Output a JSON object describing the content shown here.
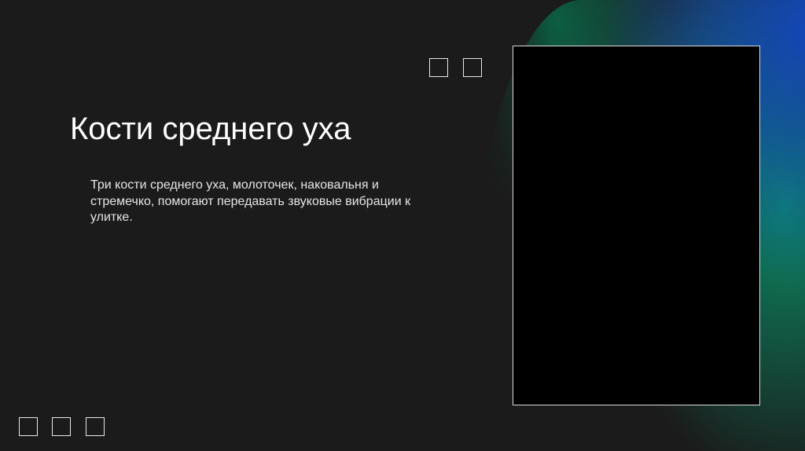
{
  "slide": {
    "title": "Кости среднего уха",
    "body": "Три кости среднего уха, молоточек, наковальня и стремечко, помогают передавать звуковые вибрации к улитке."
  },
  "colors": {
    "background": "#1b1b1b",
    "accent_blue": "#1446be",
    "accent_green": "#0a966e",
    "text": "#ffffff"
  },
  "icons": {
    "top_squares": [
      "square-outline-icon",
      "square-outline-icon"
    ],
    "bottom_squares": [
      "square-outline-icon",
      "square-outline-icon",
      "square-outline-icon"
    ]
  }
}
